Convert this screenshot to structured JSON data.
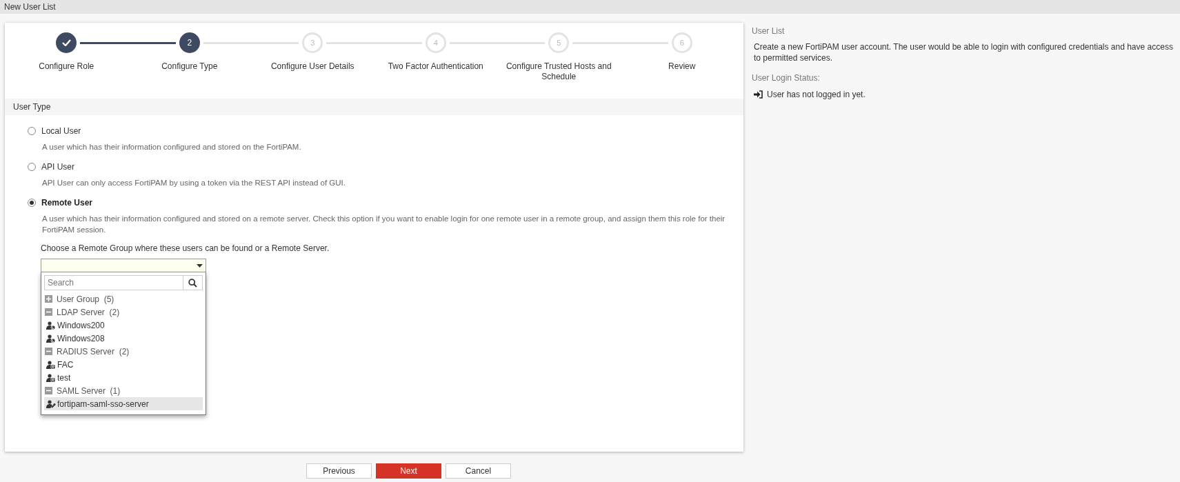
{
  "page_title": "New User List",
  "steps": [
    {
      "label": "Configure Role",
      "completed": true,
      "current": false
    },
    {
      "label": "Configure Type",
      "completed": false,
      "current": true,
      "number": "2"
    },
    {
      "label": "Configure User Details",
      "completed": false,
      "current": false,
      "number": "3"
    },
    {
      "label": "Two Factor Authentication",
      "completed": false,
      "current": false,
      "number": "4"
    },
    {
      "label": "Configure Trusted Hosts and Schedule",
      "completed": false,
      "current": false,
      "number": "5"
    },
    {
      "label": "Review",
      "completed": false,
      "current": false,
      "number": "6"
    }
  ],
  "section_title": "User Type",
  "user_types": [
    {
      "label": "Local User",
      "selected": false,
      "description": "A user which has their information configured and stored on the FortiPAM."
    },
    {
      "label": "API User",
      "selected": false,
      "description": "API User can only access FortiPAM by using a token via the REST API instead of GUI."
    },
    {
      "label": "Remote User",
      "selected": true,
      "description": "A user which has their information configured and stored on a remote server. Check this option if you want to enable login for one remote user in a remote group, and assign them this role for their FortiPAM session."
    }
  ],
  "remote_prompt": "Choose a Remote Group where these users can be found or a Remote Server.",
  "dropdown": {
    "search_placeholder": "Search",
    "groups": [
      {
        "label": "User Group",
        "count": "(5)",
        "expanded": false
      },
      {
        "label": "LDAP Server",
        "count": "(2)",
        "expanded": true,
        "children": [
          {
            "label": "Windows200",
            "kind": "ldap",
            "selected": false
          },
          {
            "label": "Windows208",
            "kind": "ldap",
            "selected": false
          }
        ]
      },
      {
        "label": "RADIUS Server",
        "count": "(2)",
        "expanded": true,
        "children": [
          {
            "label": "FAC",
            "kind": "radius",
            "selected": false
          },
          {
            "label": "test",
            "kind": "radius",
            "selected": false
          }
        ]
      },
      {
        "label": "SAML Server",
        "count": "(1)",
        "expanded": true,
        "children": [
          {
            "label": "fortipam-saml-sso-server",
            "kind": "saml",
            "selected": true
          }
        ]
      }
    ]
  },
  "buttons": [
    {
      "label": "Previous",
      "kind": "secondary"
    },
    {
      "label": "Next",
      "kind": "primary"
    },
    {
      "label": "Cancel",
      "kind": "secondary"
    }
  ],
  "side_panel": {
    "title": "User List",
    "description": "Create a new FortiPAM user account. The user would be able to login with configured credentials and have access to permitted services.",
    "status_title": "User Login Status:",
    "status_text": "User has not logged in yet."
  }
}
